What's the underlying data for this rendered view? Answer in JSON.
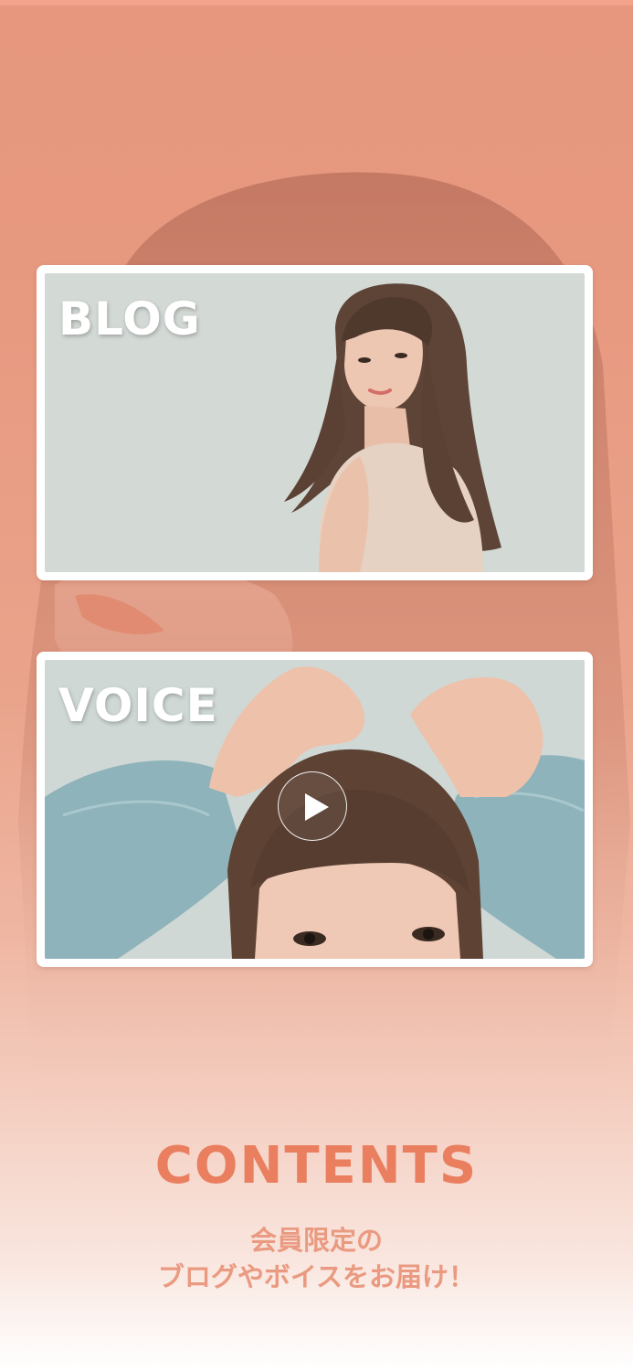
{
  "colors": {
    "background_top": "#e6977e",
    "background_bottom": "#ffffff",
    "accent": "#e97f5f",
    "subtext": "#ea9a80",
    "card_frame": "#ffffff"
  },
  "cards": [
    {
      "id": "blog",
      "title": "BLOG",
      "image": "woman-looking-over-shoulder-photo"
    },
    {
      "id": "voice",
      "title": "VOICE",
      "image": "woman-hands-on-head-photo",
      "overlay_icon": "play-icon"
    }
  ],
  "contents": {
    "heading": "CONTENTS",
    "line1": "会員限定の",
    "line2": "ブログやボイスをお届け！"
  }
}
